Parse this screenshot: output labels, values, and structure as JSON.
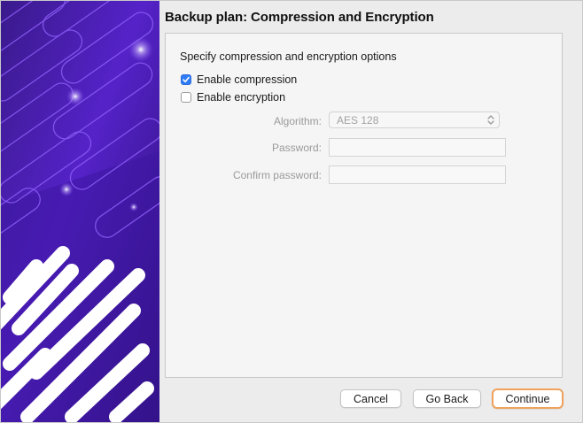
{
  "window": {
    "title": "Backup plan: Compression and Encryption"
  },
  "options": {
    "heading": "Specify compression and encryption options",
    "compression": {
      "label": "Enable compression",
      "checked": true
    },
    "encryption": {
      "label": "Enable encryption",
      "checked": false
    }
  },
  "fields": {
    "algorithm": {
      "label": "Algorithm:",
      "value": "AES 128",
      "enabled": false
    },
    "password": {
      "label": "Password:",
      "value": "",
      "enabled": false
    },
    "confirm_password": {
      "label": "Confirm password:",
      "value": "",
      "enabled": false
    }
  },
  "buttons": {
    "cancel": "Cancel",
    "go_back": "Go Back",
    "continue": "Continue"
  },
  "colors": {
    "accent": "#2f7cf6",
    "focus_ring": "#f0a25d",
    "art_purple": "#4a1bb0"
  },
  "icons": {
    "checkbox_checked": "checkmark-icon",
    "select_arrows": "chevron-up-down-icon"
  }
}
